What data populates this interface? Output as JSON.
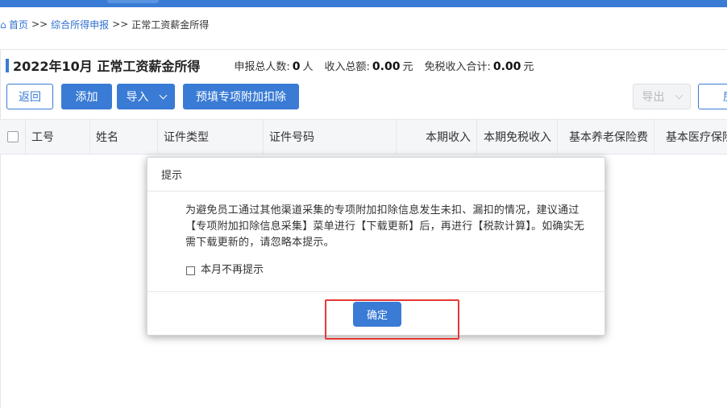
{
  "breadcrumb": {
    "home": "首页",
    "separator": ">>",
    "level2": "综合所得申报",
    "current": "正常工资薪金所得"
  },
  "header": {
    "title": "2022年10月 正常工资薪金所得",
    "summary": {
      "people_label": "申报总人数:",
      "people_value": "0",
      "people_unit": "人",
      "income_label": "收入总额:",
      "income_value": "0.00",
      "income_unit": "元",
      "exempt_label": "免税收入合计:",
      "exempt_value": "0.00",
      "exempt_unit": "元"
    }
  },
  "toolbar": {
    "back": "返回",
    "add": "添加",
    "import": "导入",
    "prefill": "预填专项附加扣除",
    "export": "导出",
    "right_partial": "房"
  },
  "table": {
    "columns": [
      "工号",
      "姓名",
      "证件类型",
      "证件号码",
      "本期收入",
      "本期免税收入",
      "基本养老保险费",
      "基本医疗保险"
    ]
  },
  "modal": {
    "title": "提示",
    "message": "为避免员工通过其他渠道采集的专项附加扣除信息发生未扣、漏扣的情况，建议通过【专项附加扣除信息采集】菜单进行【下载更新】后，再进行【税款计算】。如确实无需下载更新的，请忽略本提示。",
    "checkbox_label": "本月不再提示",
    "confirm": "确定"
  },
  "colors": {
    "primary": "#3a7bd5",
    "highlight": "#e53935"
  }
}
